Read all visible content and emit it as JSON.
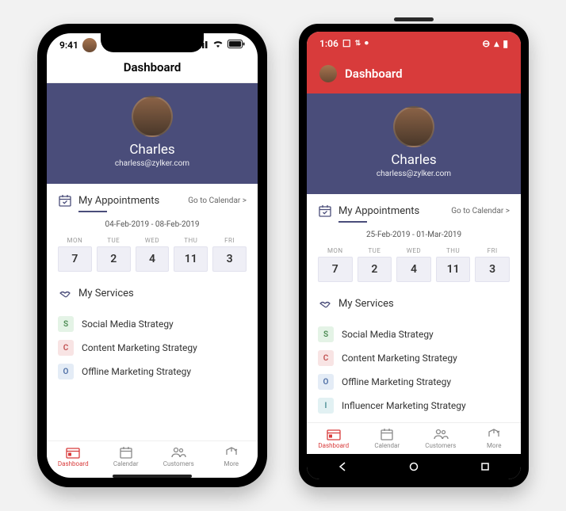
{
  "ios": {
    "status_time": "9:41",
    "title": "Dashboard",
    "user": {
      "name": "Charles",
      "email": "charless@zylker.com"
    },
    "appointments": {
      "title": "My Appointments",
      "cta": "Go to Calendar  >",
      "range": "04-Feb-2019 - 08-Feb-2019",
      "days": [
        {
          "lbl": "MON",
          "num": "7"
        },
        {
          "lbl": "TUE",
          "num": "2"
        },
        {
          "lbl": "WED",
          "num": "4"
        },
        {
          "lbl": "THU",
          "num": "11"
        },
        {
          "lbl": "FRI",
          "num": "3"
        }
      ]
    },
    "services": {
      "title": "My Services",
      "items": [
        {
          "badge": "S",
          "cls": "b-green",
          "name": "Social Media Strategy"
        },
        {
          "badge": "C",
          "cls": "b-red",
          "name": "Content Marketing Strategy"
        },
        {
          "badge": "O",
          "cls": "b-blue",
          "name": "Offline Marketing Strategy"
        }
      ]
    },
    "tabs": [
      {
        "name": "Dashboard",
        "active": true
      },
      {
        "name": "Calendar",
        "active": false
      },
      {
        "name": "Customers",
        "active": false
      },
      {
        "name": "More",
        "active": false
      }
    ]
  },
  "android": {
    "status_time": "1:06",
    "title": "Dashboard",
    "user": {
      "name": "Charles",
      "email": "charless@zylker.com"
    },
    "appointments": {
      "title": "My Appointments",
      "cta": "Go to Calendar  >",
      "range": "25-Feb-2019 - 01-Mar-2019",
      "days": [
        {
          "lbl": "MON",
          "num": "7"
        },
        {
          "lbl": "TUE",
          "num": "2"
        },
        {
          "lbl": "WED",
          "num": "4"
        },
        {
          "lbl": "THU",
          "num": "11"
        },
        {
          "lbl": "FRI",
          "num": "3"
        }
      ]
    },
    "services": {
      "title": "My Services",
      "items": [
        {
          "badge": "S",
          "cls": "b-green",
          "name": "Social Media Strategy"
        },
        {
          "badge": "C",
          "cls": "b-red",
          "name": "Content Marketing Strategy"
        },
        {
          "badge": "O",
          "cls": "b-blue",
          "name": "Offline Marketing Strategy"
        },
        {
          "badge": "I",
          "cls": "b-cyan",
          "name": "Influencer Marketing Strategy"
        }
      ]
    },
    "tabs": [
      {
        "name": "Dashboard",
        "active": true
      },
      {
        "name": "Calendar",
        "active": false
      },
      {
        "name": "Customers",
        "active": false
      },
      {
        "name": "More",
        "active": false
      }
    ]
  }
}
